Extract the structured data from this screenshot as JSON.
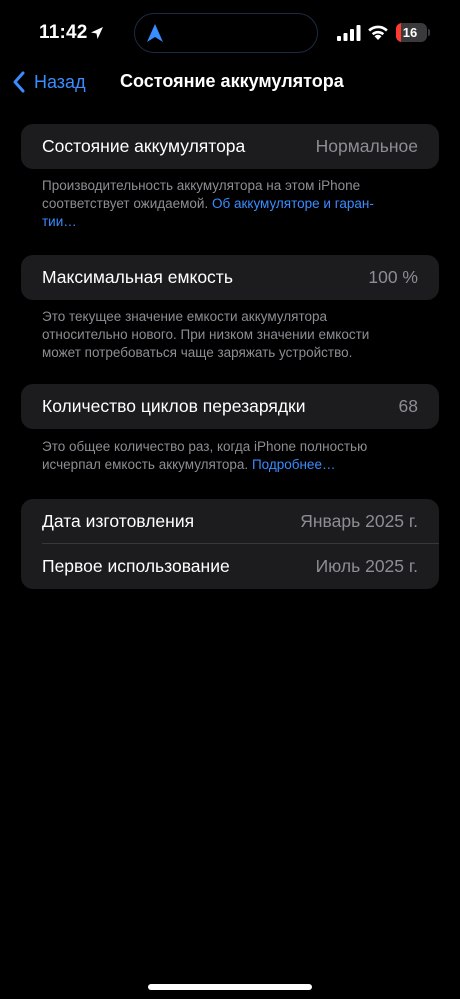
{
  "status_bar": {
    "time": "11:42",
    "battery_level": "16",
    "battery_fraction": 0.16,
    "battery_color": "#ff3b30",
    "icons": [
      "location-arrow-icon",
      "navigation-icon",
      "cellular-signal-icon",
      "wifi-icon",
      "battery-icon"
    ]
  },
  "nav": {
    "back_label": "Назад",
    "title": "Состояние аккумулятора"
  },
  "accent_color": "#3a8cff",
  "sections": {
    "battery_health": {
      "label": "Состояние аккумулятора",
      "value": "Нормальное",
      "footnote": "Производительность аккумулятора на этом iPhone соответствует ожидаемой.",
      "footnote_link": "Об аккумуляторе и гаран­тии…"
    },
    "max_capacity": {
      "label": "Максимальная емкость",
      "value": "100 %",
      "footnote": "Это текущее значение емкости аккумулятора относительно нового. При низком значении емкости может потребоваться чаще заряжать устройство."
    },
    "cycle_count": {
      "label": "Количество циклов перезарядки",
      "value": "68",
      "footnote": "Это общее количество раз, когда iPhone полностью исчерпал емкость аккумулятора.",
      "footnote_link": "Подробнее…"
    },
    "dates": {
      "manufacture_label": "Дата изготовления",
      "manufacture_value": "Январь 2025 г.",
      "first_use_label": "Первое использование",
      "first_use_value": "Июль 2025 г."
    }
  }
}
